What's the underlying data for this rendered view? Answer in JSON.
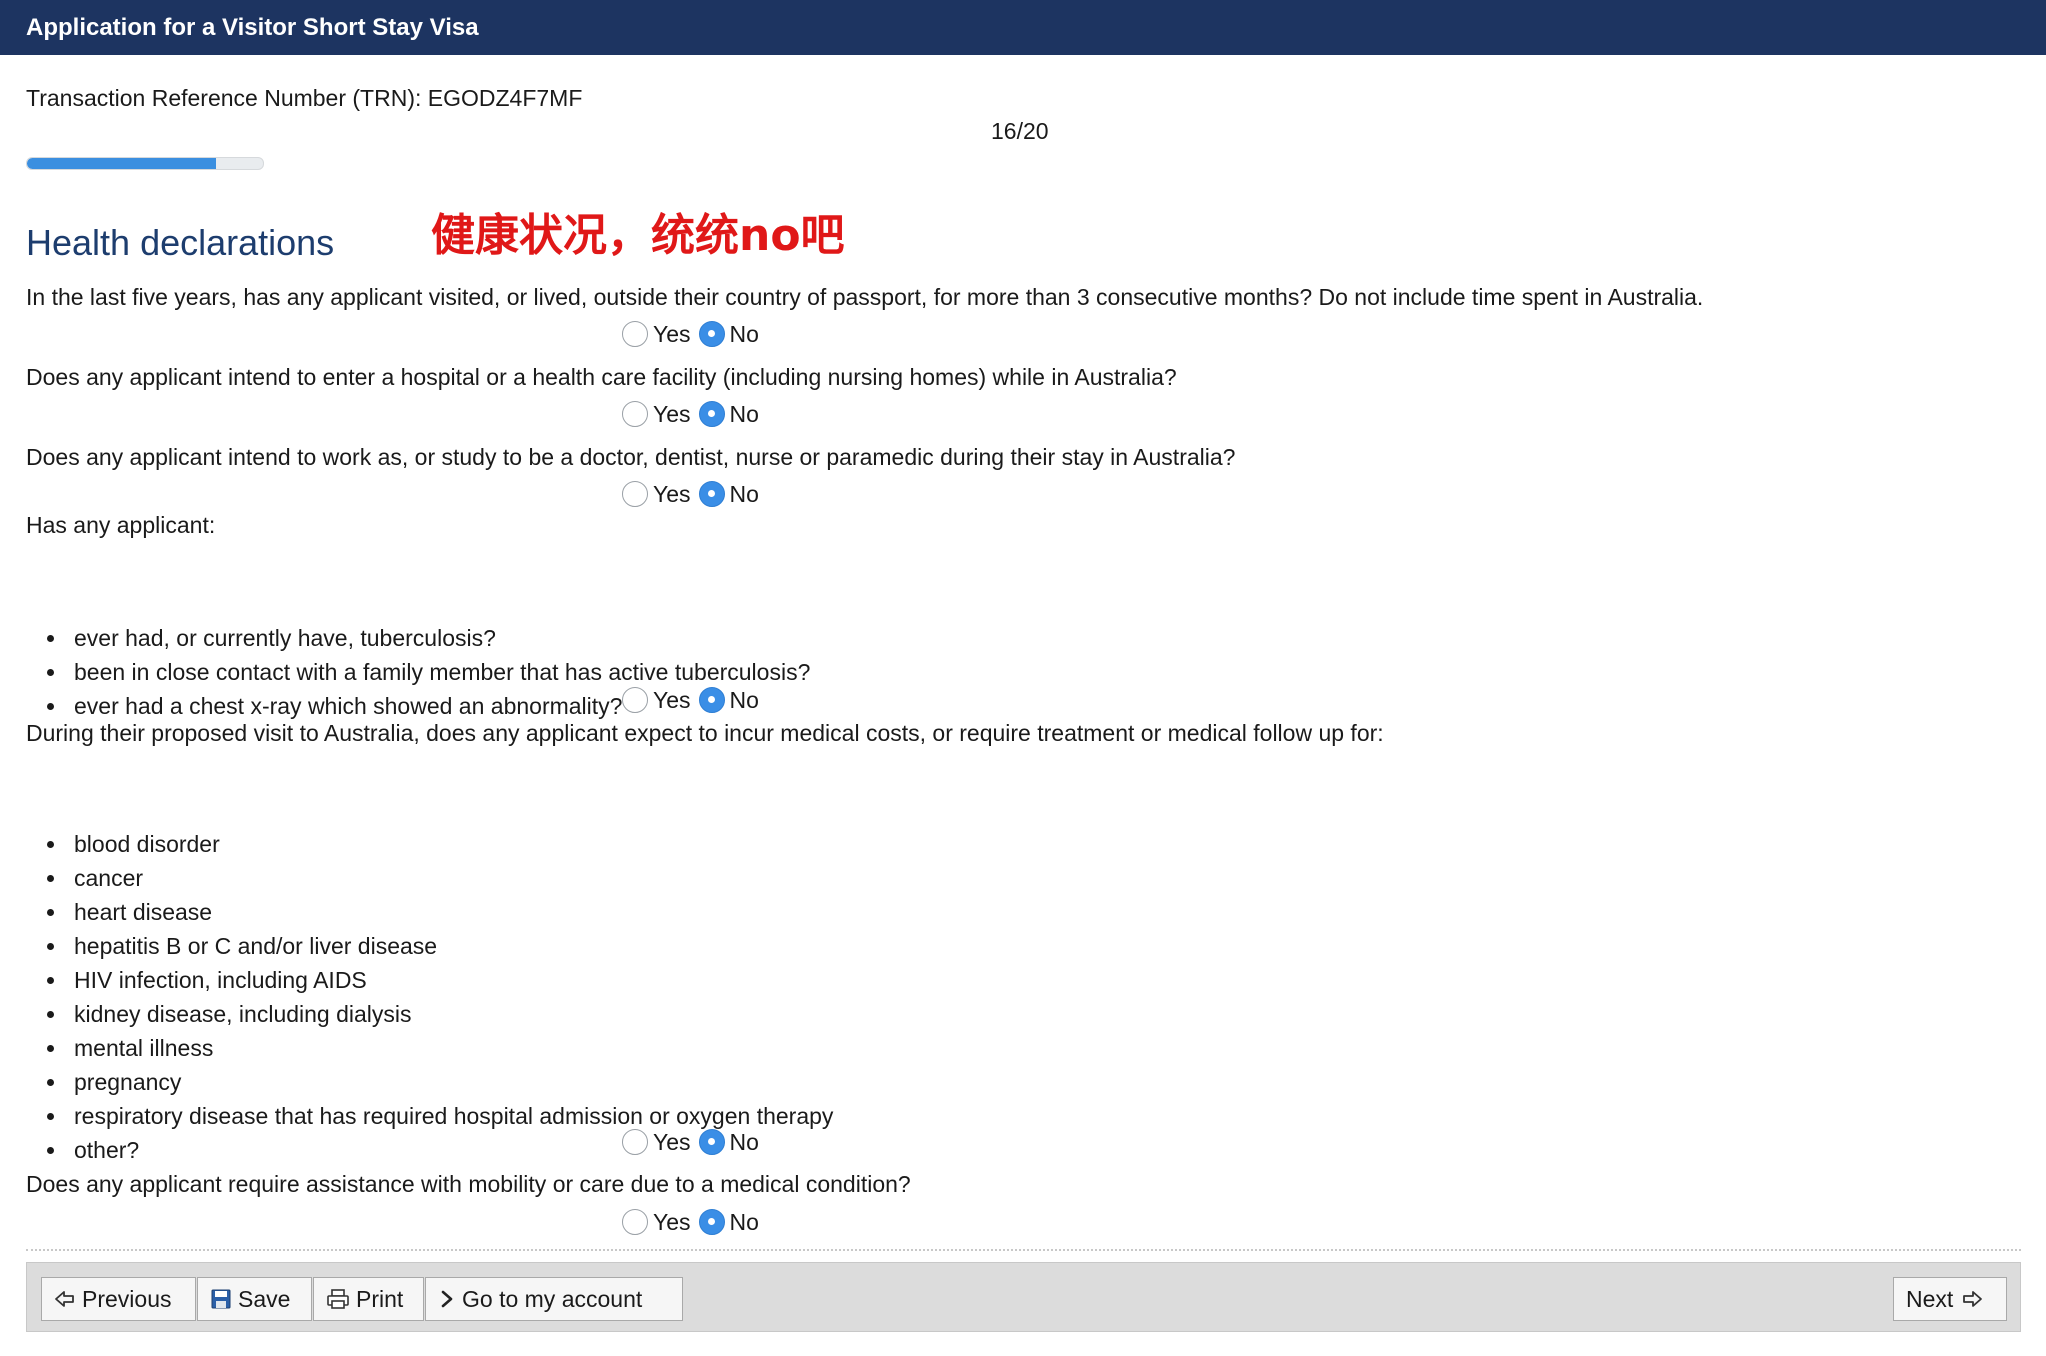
{
  "window": {
    "title": "Application for a Visitor Short Stay Visa"
  },
  "trn": {
    "label": "Transaction Reference Number (TRN): EGODZ4F7MF"
  },
  "progress": {
    "page_text": "16/20",
    "current": 16,
    "total": 20,
    "fraction": 0.8
  },
  "section": {
    "title": "Health declarations"
  },
  "annotation": {
    "text": "健康状况，统统no吧"
  },
  "questions": [
    {
      "text": "In the last five years, has any applicant visited, or lived, outside their country of passport, for more than 3 consecutive months? Do not include time spent in Australia.",
      "yes": "Yes",
      "no": "No",
      "selected": "No"
    },
    {
      "text": "Does any applicant intend to enter a hospital or a health care facility (including nursing homes) while in Australia?",
      "yes": "Yes",
      "no": "No",
      "selected": "No"
    },
    {
      "text": "Does any applicant intend to work as, or study to be a doctor, dentist, nurse or paramedic during their stay in Australia?",
      "yes": "Yes",
      "no": "No",
      "selected": "No"
    },
    {
      "text": "Has any applicant:",
      "bullets": [
        "ever had, or currently have, tuberculosis?",
        "been in close contact with a family member that has active tuberculosis?",
        "ever had a chest x-ray which showed an abnormality?"
      ],
      "yes": "Yes",
      "no": "No",
      "selected": "No"
    },
    {
      "text": "During their proposed visit to Australia, does any applicant expect to incur medical costs, or require treatment or medical follow up for:",
      "bullets": [
        "blood disorder",
        "cancer",
        "heart disease",
        "hepatitis B or C and/or liver disease",
        "HIV infection, including AIDS",
        "kidney disease, including dialysis",
        "mental illness",
        "pregnancy",
        "respiratory disease that has required hospital admission or oxygen therapy",
        "other?"
      ],
      "yes": "Yes",
      "no": "No",
      "selected": "No"
    },
    {
      "text": "Does any applicant require assistance with mobility or care due to a medical condition?",
      "yes": "Yes",
      "no": "No",
      "selected": "No"
    }
  ],
  "toolbar": {
    "previous": "Previous",
    "save": "Save",
    "print": "Print",
    "account": "Go to my account",
    "next": "Next"
  },
  "icons": {
    "previous": "arrow-left-icon",
    "save": "floppy-disk-icon",
    "print": "printer-icon",
    "account": "chevron-right-icon",
    "next": "arrow-right-icon"
  },
  "colors": {
    "titlebar": "#1d3461",
    "heading": "#1d3d6e",
    "annotation": "#e01818",
    "radio_selected": "#3a8ee6",
    "progress": "#3b8fe0"
  }
}
